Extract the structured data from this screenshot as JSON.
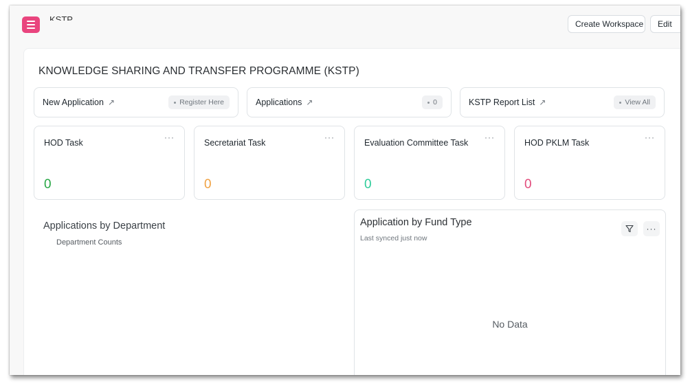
{
  "workspace": {
    "title": "KSTP"
  },
  "topbar": {
    "create_workspace_label": "Create Workspace",
    "edit_label": "Edit"
  },
  "page": {
    "title": "KNOWLEDGE SHARING AND TRANSFER PROGRAMME (KSTP)"
  },
  "shortcuts": [
    {
      "label": "New Application",
      "pill": "Register Here"
    },
    {
      "label": "Applications",
      "pill": "0"
    },
    {
      "label": "KSTP Report List",
      "pill": "View All"
    }
  ],
  "arrow_glyph": "↗",
  "more_glyph": "···",
  "cards": [
    {
      "title": "HOD Task",
      "value": "0",
      "color": "#28a745"
    },
    {
      "title": "Secretariat Task",
      "value": "0",
      "color": "#f0a243"
    },
    {
      "title": "Evaluation Committee Task",
      "value": "0",
      "color": "#2ecc9a"
    },
    {
      "title": "HOD PKLM Task",
      "value": "0",
      "color": "#e24c7c"
    }
  ],
  "charts": {
    "department": {
      "title": "Applications by Department",
      "legend": "Department Counts"
    },
    "fund_type": {
      "title": "Application by Fund Type",
      "subtitle": "Last synced just now",
      "empty_text": "No Data"
    }
  },
  "colors": {
    "accent": "#e9457e"
  },
  "icons": {
    "menu": "menu-icon",
    "filter": "filter-icon",
    "more": "more-icon",
    "external_link": "arrow-up-right-icon"
  }
}
